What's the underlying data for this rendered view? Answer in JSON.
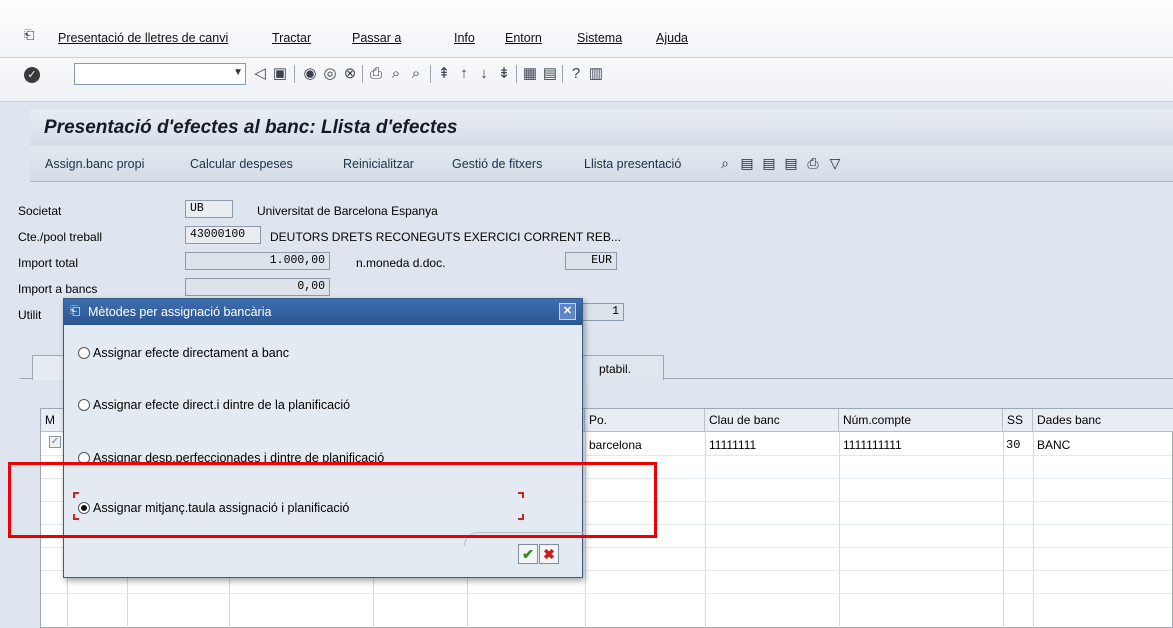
{
  "menu": {
    "items": [
      "Presentació de lletres de canvi",
      "Tractar",
      "Passar a",
      "Info",
      "Entorn",
      "Sistema",
      "Ajuda"
    ]
  },
  "toolbar": {
    "command_field_value": ""
  },
  "title": "Presentació d'efectes al banc: Llista d'efectes",
  "app_toolbar": {
    "buttons": [
      "Assign.banc propi",
      "Calcular despeses",
      "Reinicialitzar",
      "Gestió de fitxers",
      "Llista presentació"
    ]
  },
  "header": {
    "societat_label": "Societat",
    "societat_value": "UB",
    "societat_text": "Universitat de Barcelona Espanya",
    "pool_label": "Cte./pool treball",
    "pool_value": "43000100",
    "pool_text": "DEUTORS DRETS RECONEGUTS EXERCICI CORRENT REB...",
    "import_total_label": "Import total",
    "import_total_value": "1.000,00",
    "moneda_label": "n.moneda d.doc.",
    "moneda_value": "EUR",
    "import_bancs_label": "Import a bancs",
    "import_bancs_value": "0,00",
    "utilit_label": "Utilit",
    "utilit_value": "1"
  },
  "tabs": [
    "ptabil."
  ],
  "grid": {
    "columns": [
      "M",
      "Po.",
      "Clau de banc",
      "Núm.compte",
      "SS",
      "Dades banc"
    ],
    "rows": [
      {
        "po": "barcelona",
        "clau": "11111111",
        "compte": "1111111111",
        "ss": "30",
        "dades": "BANC"
      }
    ]
  },
  "dialog": {
    "title": "Mètodes per assignació bancària",
    "options": [
      {
        "label": "Assignar efecte directament a banc",
        "selected": false
      },
      {
        "label": "Assignar efecte direct.i dintre de la planificació",
        "selected": false
      },
      {
        "label": "Assignar desp.perfeccionades i dintre de planificació",
        "selected": false
      },
      {
        "label": "Assignar mitjanç.taula assignació i planificació",
        "selected": true
      }
    ]
  },
  "colors": {
    "title_bar": "#2b5592",
    "highlight": "#ee0000",
    "confirm": "#2e8b1e",
    "cancel": "#cc1a1a"
  }
}
